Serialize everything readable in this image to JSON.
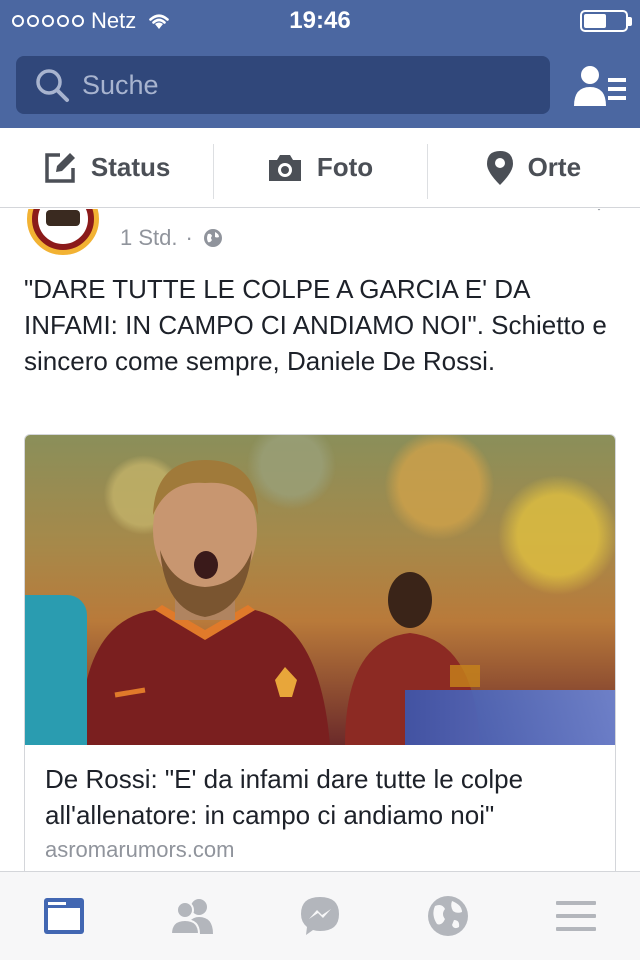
{
  "status_bar": {
    "carrier": "Netz",
    "time": "19:46",
    "battery_level": 0.6
  },
  "search": {
    "placeholder": "Suche",
    "icon": "search-icon"
  },
  "header": {
    "friend_requests_icon": "friend-requests-icon"
  },
  "composer": {
    "status_label": "Status",
    "photo_label": "Foto",
    "checkin_label": "Orte"
  },
  "post": {
    "timestamp": "1 Std.",
    "separator": "·",
    "privacy_icon": "globe-icon",
    "text": "\"DARE TUTTE LE COLPE A GARCIA E' DA INFAMI: IN CAMPO CI ANDIAMO NOI\". Schietto e sincero come sempre, Daniele De Rossi.",
    "link": {
      "title": "De Rossi: \"E' da infami dare tutte le colpe all'allenatore: in campo ci andiamo noi\"",
      "domain": "asromarumors.com"
    }
  },
  "tabbar": {
    "tabs": [
      {
        "icon": "news-feed-icon",
        "active": true
      },
      {
        "icon": "friends-icon",
        "active": false
      },
      {
        "icon": "messenger-icon",
        "active": false
      },
      {
        "icon": "notifications-globe-icon",
        "active": false
      },
      {
        "icon": "menu-icon",
        "active": false
      }
    ]
  },
  "colors": {
    "brand_blue": "#4b67a1",
    "search_bg": "#30477a",
    "active_tab": "#4267b2",
    "inactive_tab": "#b3b6bc"
  }
}
